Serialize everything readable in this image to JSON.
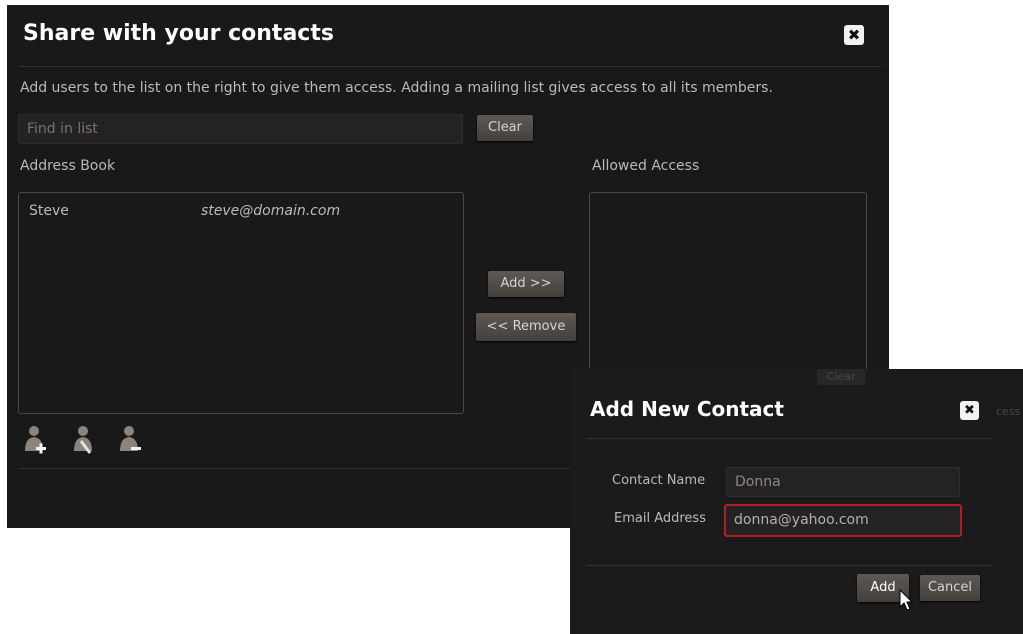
{
  "main_dialog": {
    "title": "Share with your contacts",
    "close_glyph": "✖",
    "instructions": "Add users to the list on the right to give them access.  Adding a mailing list gives access to all its members.",
    "search_placeholder": "Find in list",
    "clear_label": "Clear",
    "address_book_label": "Address Book",
    "allowed_access_label": "Allowed Access",
    "contacts": [
      {
        "name": "Steve",
        "email": "steve@domain.com"
      }
    ],
    "add_label": "Add >>",
    "remove_label": "<< Remove",
    "allowed_clear_label": "Clear",
    "icons": [
      "add-contact-icon",
      "edit-contact-icon",
      "remove-contact-icon"
    ]
  },
  "add_contact_dialog": {
    "title": "Add New Contact",
    "close_glyph": "✖",
    "contact_name_label": "Contact Name",
    "contact_name_value": "Donna",
    "email_label": "Email Address",
    "email_value": "donna@yahoo.com",
    "add_label": "Add",
    "cancel_label": "Cancel",
    "background_peek_text": "cess"
  },
  "colors": {
    "dialog_bg": "#1a1919",
    "button": "#524d49",
    "error_border": "#b51e1e"
  }
}
